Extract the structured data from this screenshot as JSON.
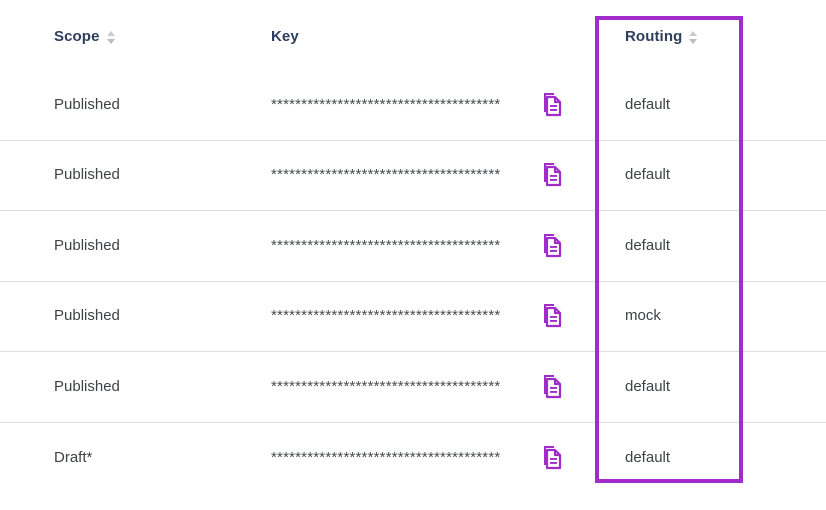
{
  "table": {
    "columns": [
      {
        "key": "scope",
        "label": "Scope",
        "sortable": true,
        "sort_icon": "sort-updown-icon"
      },
      {
        "key": "key",
        "label": "Key",
        "sortable": false,
        "sort_icon": null
      },
      {
        "key": "routing",
        "label": "Routing",
        "sortable": true,
        "sort_icon": "sort-updown-icon"
      }
    ],
    "rows": [
      {
        "scope": "Published",
        "key": "**************************************",
        "copy_icon": "copy-document-icon",
        "routing": "default"
      },
      {
        "scope": "Published",
        "key": "**************************************",
        "copy_icon": "copy-document-icon",
        "routing": "default"
      },
      {
        "scope": "Published",
        "key": "**************************************",
        "copy_icon": "copy-document-icon",
        "routing": "default"
      },
      {
        "scope": "Published",
        "key": "**************************************",
        "copy_icon": "copy-document-icon",
        "routing": "mock"
      },
      {
        "scope": "Published",
        "key": "**************************************",
        "copy_icon": "copy-document-icon",
        "routing": "default"
      },
      {
        "scope": "Draft*",
        "key": "**************************************",
        "copy_icon": "copy-document-icon",
        "routing": "default"
      }
    ]
  },
  "highlight": {
    "name": "routing-column-highlight",
    "color": "#a22ccb",
    "target_column": "Routing"
  },
  "colors": {
    "header_text": "#2e3e5c",
    "body_text": "#3f4246",
    "row_divider": "#dcdee2",
    "icon_purple": "#a22ccb",
    "sort_arrow": "#c9ccd3",
    "background": "#ffffff"
  }
}
